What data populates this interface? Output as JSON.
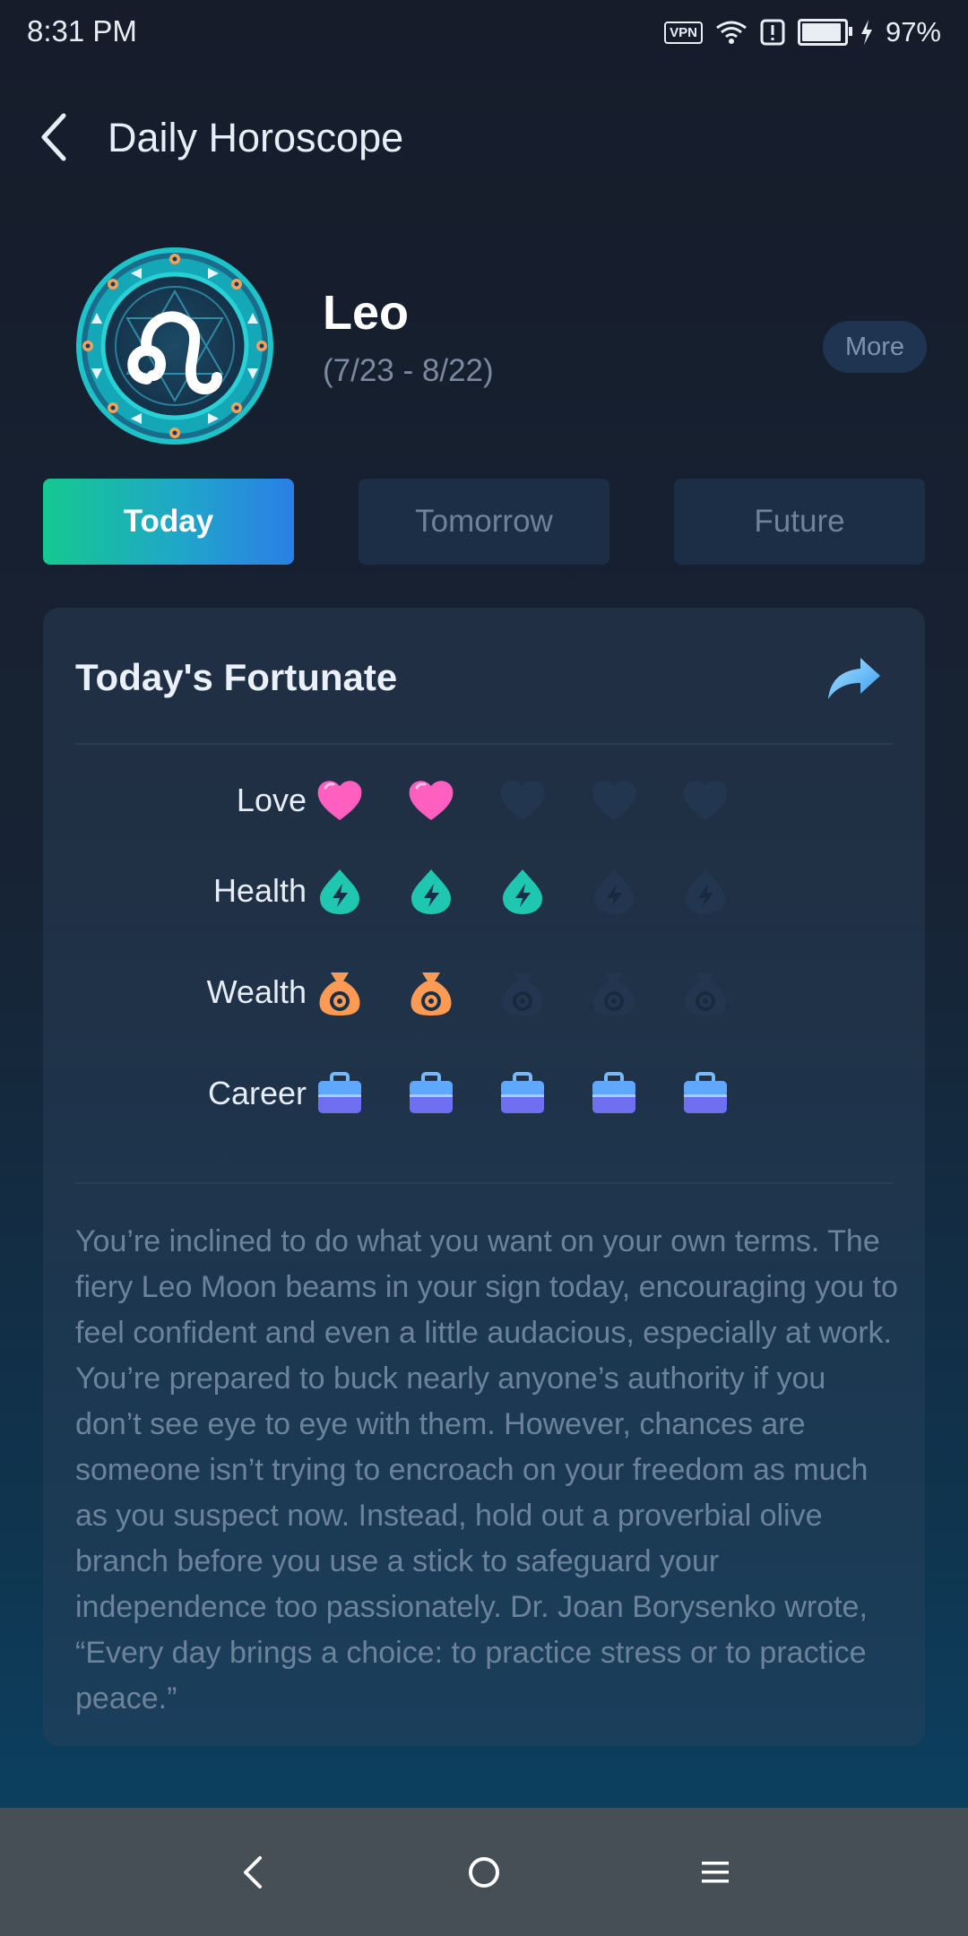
{
  "status_bar": {
    "time": "8:31 PM",
    "vpn": "VPN",
    "battery_percent": "97%",
    "battery_level": 0.97,
    "icons": [
      "vpn-icon",
      "wifi-icon",
      "alert-icon",
      "battery-icon",
      "charging-icon"
    ]
  },
  "header": {
    "title": "Daily Horoscope",
    "back_icon": "chevron-left-icon"
  },
  "sign": {
    "name": "Leo",
    "dates": "(7/23 - 8/22)",
    "more_label": "More",
    "emblem_icon": "leo-zodiac-emblem"
  },
  "tabs": [
    {
      "label": "Today",
      "active": true
    },
    {
      "label": "Tomorrow",
      "active": false
    },
    {
      "label": "Future",
      "active": false
    }
  ],
  "card": {
    "title": "Today's Fortunate",
    "share_icon": "share-arrow-icon",
    "ratings": [
      {
        "label": "Love",
        "icon": "heart-icon",
        "value": 2,
        "max": 5,
        "color": "#ff5fbf"
      },
      {
        "label": "Health",
        "icon": "health-drop-icon",
        "value": 3,
        "max": 5,
        "color": "#1fc6b0"
      },
      {
        "label": "Wealth",
        "icon": "money-bag-icon",
        "value": 2,
        "max": 5,
        "color": "#ff9a55"
      },
      {
        "label": "Career",
        "icon": "briefcase-icon",
        "value": 5,
        "max": 5,
        "color": "#5b7bf5"
      }
    ],
    "reading": "You’re inclined to do what you want on your own terms. The fiery Leo Moon beams in your sign today, encouraging you to feel confident and even a little audacious, especially at work. You’re prepared to buck nearly anyone’s authority if you don’t see eye to eye with them. However, chances are someone isn’t trying to encroach on your freedom as much as you suspect now. Instead, hold out a proverbial olive branch before you use a stick to safeguard your independence too passionately. Dr. Joan Borysenko wrote, “Every day brings a choice: to practice stress or to practice peace.”"
  },
  "nav_bar": {
    "buttons": [
      "nav-back-icon",
      "nav-home-icon",
      "nav-menu-icon"
    ]
  },
  "colors": {
    "background_top": "#161c2a",
    "background_bottom": "#0c3f5e",
    "accent_gradient_start": "#14c98f",
    "accent_gradient_end": "#2b7fe6",
    "inactive_icon": "#22364f",
    "muted_text": "#6d839c"
  }
}
